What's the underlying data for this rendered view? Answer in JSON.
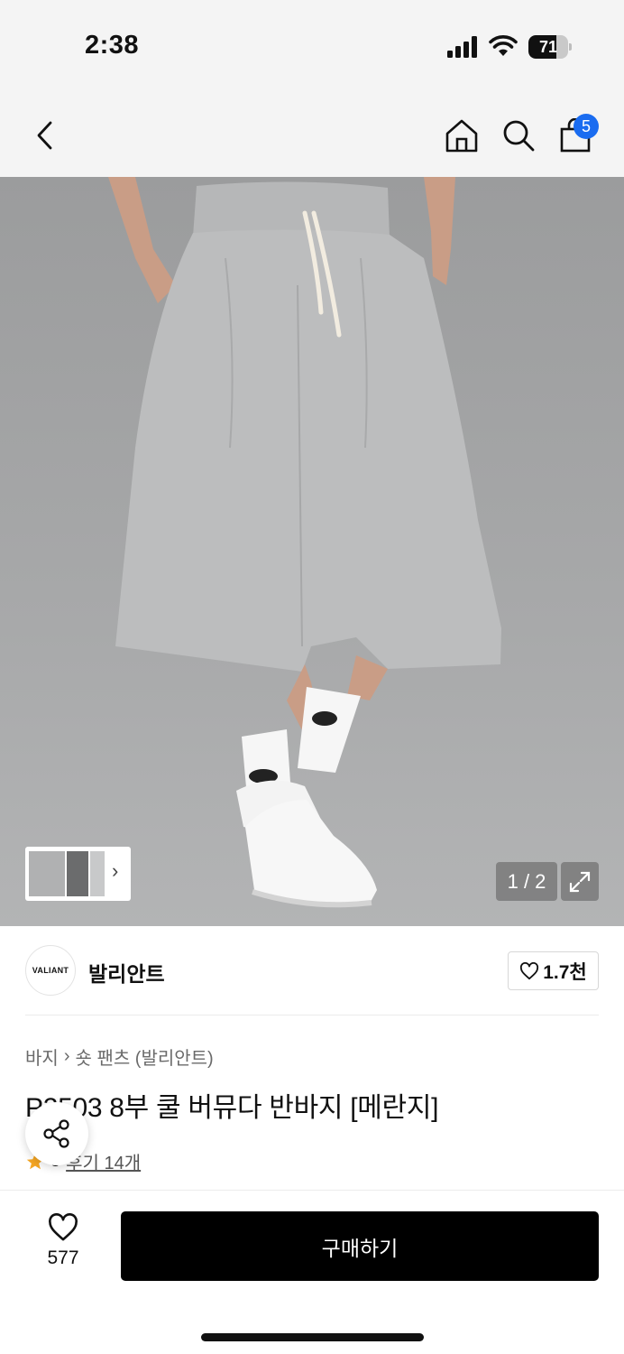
{
  "status_bar": {
    "time": "2:38",
    "battery_level": "71",
    "battery_fraction": 0.71
  },
  "header": {
    "icons": [
      "chevron-left-icon",
      "home-icon",
      "search-icon",
      "shopping-bag-icon"
    ],
    "cart_badge": "5",
    "badge_color": "#1a6cf0"
  },
  "gallery": {
    "page_counter": "1 / 2",
    "thumb_chevron": "›",
    "image_subject": "gray wide bermuda shorts with white drawstring, white socks and white sneakers"
  },
  "brand": {
    "logo_text": "VALIANT",
    "name": "발리안트",
    "like_count": "1.7천"
  },
  "breadcrumb": {
    "category": "바지",
    "separator": "›",
    "subcategory": "숏 팬츠 (발리안트)"
  },
  "product": {
    "title": "P2503 8부 쿨 버뮤다 반바지 [메란지]",
    "rating": "5",
    "star_color": "#f5a623",
    "reviews_label": "후기 14개"
  },
  "bottom_bar": {
    "wish_count": "577",
    "buy_label": "구매하기"
  }
}
